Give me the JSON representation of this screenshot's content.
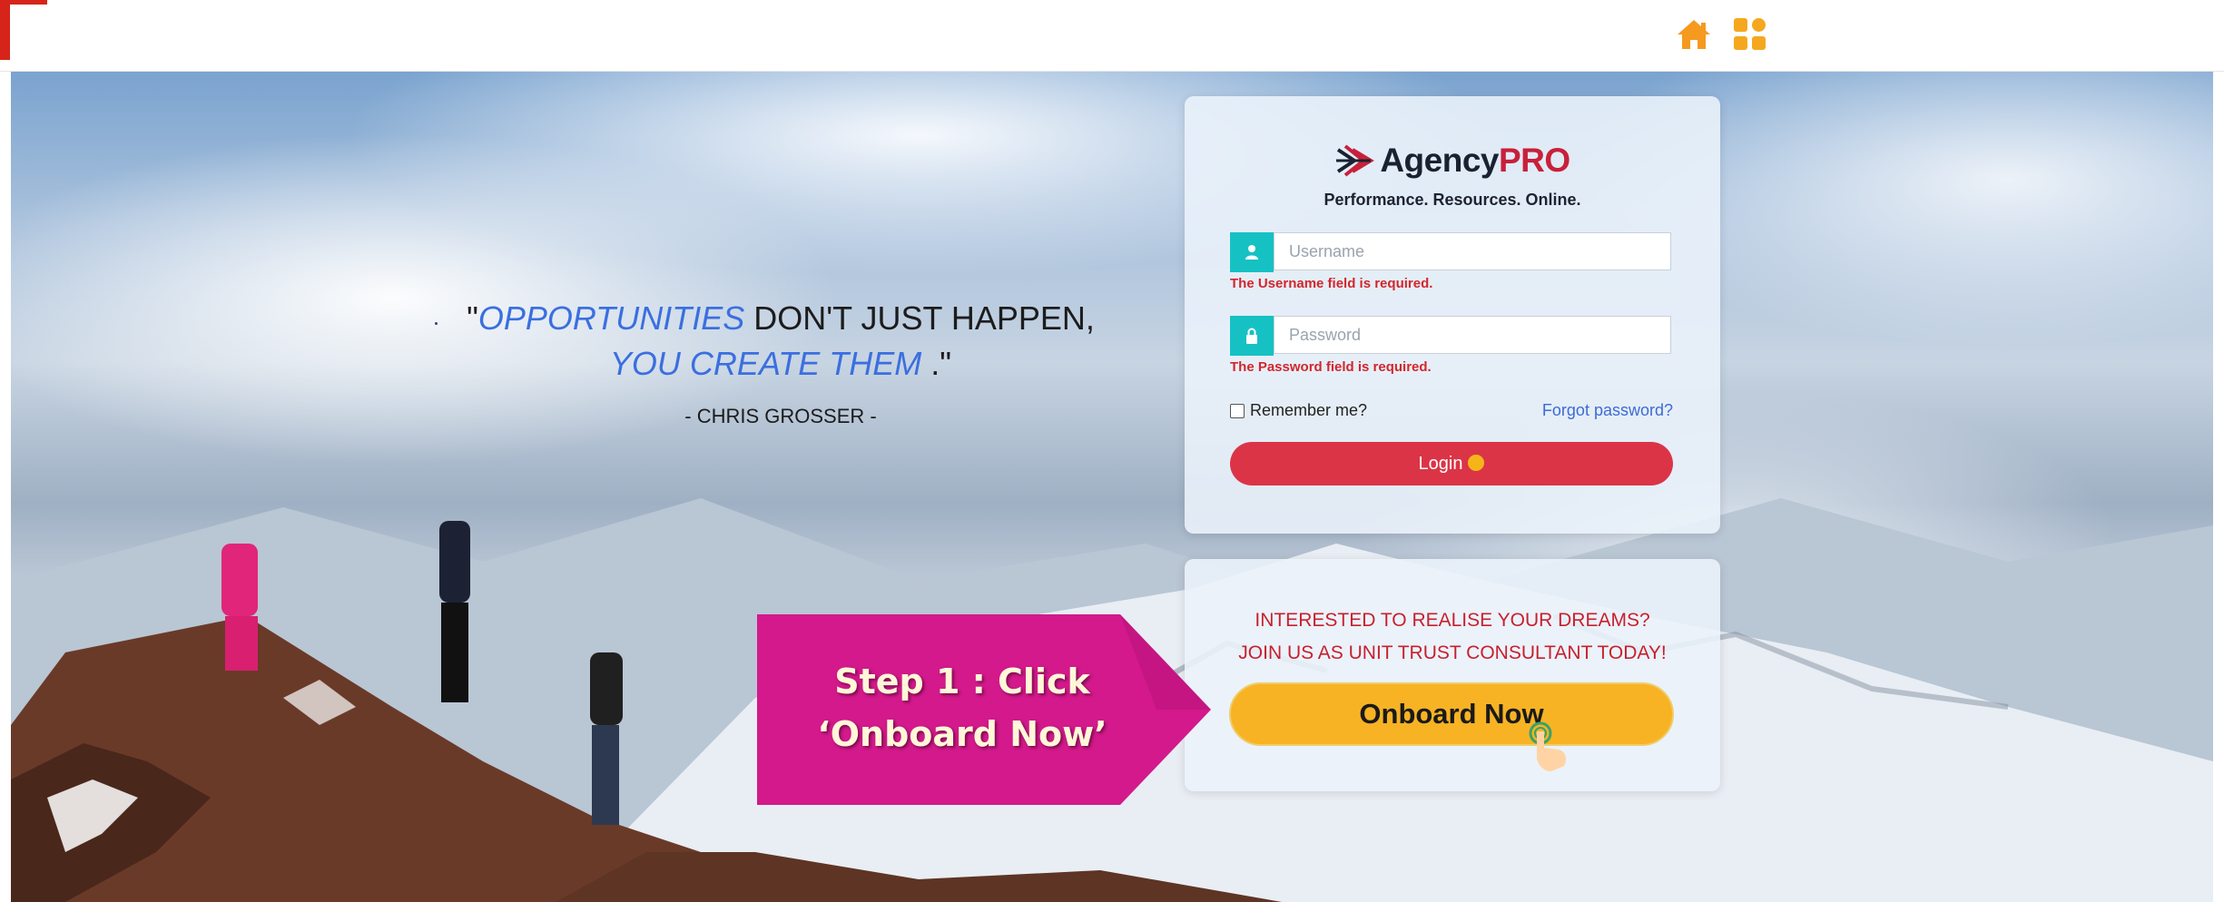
{
  "colors": {
    "accent_red": "#d6241a",
    "brand_blue": "#1a2130",
    "brand_red": "#c8203a",
    "addon_teal": "#16c1c4",
    "login_button": "#db3447",
    "onboard_button": "#f7b324",
    "callout_magenta": "#d3198c",
    "error_red": "#d3262c",
    "quote_blue": "#3b6fe0"
  },
  "topbar": {
    "home_icon": "home-icon",
    "apps_icon": "apps-grid-icon"
  },
  "quote": {
    "open_mark": "\"",
    "accent_1": "OPPORTUNITIES",
    "plain_1": " DON'T JUST HAPPEN,",
    "accent_2": "YOU CREATE THEM",
    "close_mark": " .\"",
    "author": "- CHRIS GROSSER -"
  },
  "login": {
    "brand_main": "Agency",
    "brand_accent": "PRO",
    "tagline": "Performance. Resources. Online.",
    "username": {
      "placeholder": "Username",
      "value": "",
      "error": "The Username field is required."
    },
    "password": {
      "placeholder": "Password",
      "value": "",
      "error": "The Password field is required."
    },
    "remember_label": "Remember me?",
    "remember_checked": false,
    "forgot_label": "Forgot password?",
    "login_label": "Login"
  },
  "onboard": {
    "line1": "INTERESTED TO REALISE YOUR DREAMS?",
    "line2": "JOIN US AS UNIT TRUST CONSULTANT TODAY!",
    "button_label": "Onboard Now"
  },
  "callout": {
    "line1": "Step 1 : Click",
    "line2": "‘Onboard Now’"
  }
}
